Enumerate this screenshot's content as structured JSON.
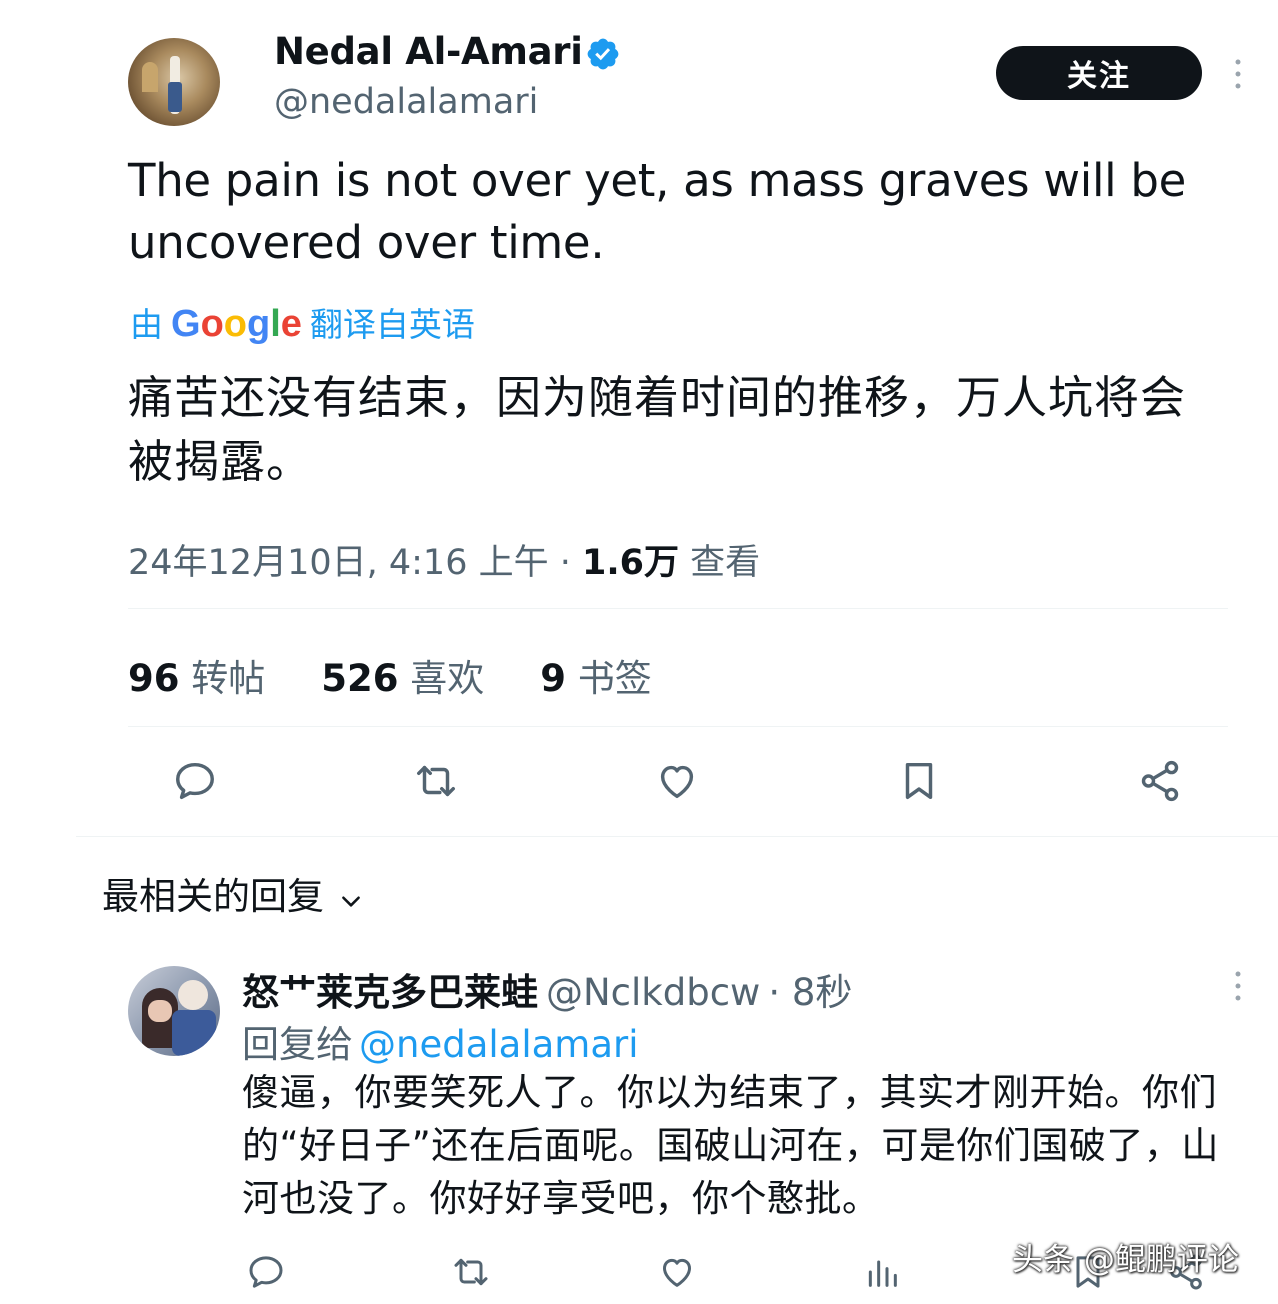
{
  "author": {
    "name": "Nedal Al-Amari",
    "handle": "@nedalalamari",
    "follow_label": "关注"
  },
  "tweet": {
    "text": "The pain is not over yet, as mass graves will be uncovered over time.",
    "translate_prefix": "由",
    "translate_brand": "Google",
    "translate_suffix": "翻译自英语",
    "translated_text": "痛苦还没有结束，因为随着时间的推移，万人坑将会被揭露。",
    "date": "24年12月10日, 4:16 上午 ·",
    "views_count": "1.6万",
    "views_label": "查看"
  },
  "stats": [
    {
      "count": "96",
      "label": "转帖"
    },
    {
      "count": "526",
      "label": "喜欢"
    },
    {
      "count": "9",
      "label": "书签"
    }
  ],
  "actions": [
    "reply-icon",
    "repost-icon",
    "like-icon",
    "bookmark-icon",
    "share-icon"
  ],
  "replies_header": "最相关的回复",
  "reply": {
    "name": "怒艹莱克多巴莱蛙",
    "handle": "@Nclkdbcw",
    "time": "· 8秒",
    "replying_prefix": "回复给",
    "replying_to": "@nedalalamari",
    "text": "傻逼，你要笑死人了。你以为结束了，其实才刚开始。你们的“好日子”还在后面呢。国破山河在，可是你们国破了，山河也没了。你好好享受吧，你个憨批。"
  },
  "reply_actions": [
    "reply-icon",
    "repost-icon",
    "like-icon",
    "views-icon",
    "bookmark-icon",
    "share-icon"
  ],
  "watermark": "头条 @鲲鹏评论",
  "colors": {
    "text": "#0f1419",
    "secondary": "#536471",
    "accent": "#1d9bf0",
    "divider": "#eff3f4",
    "button": "#0f1419"
  }
}
